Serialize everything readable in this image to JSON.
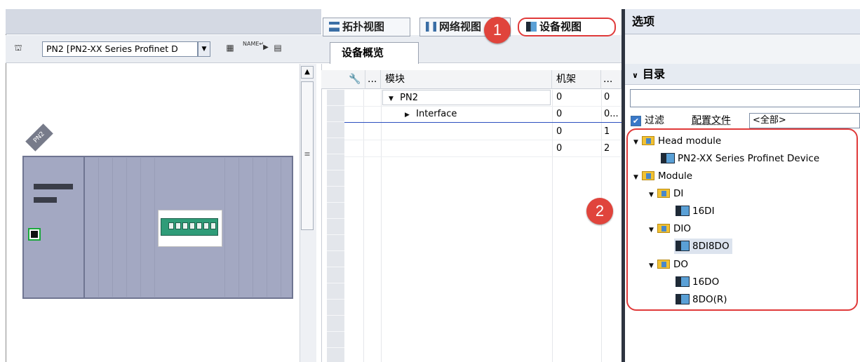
{
  "tabs": {
    "topology": "拓扑视图",
    "network": "网络视图",
    "device": "设备视图"
  },
  "callouts": {
    "one": "1",
    "two": "2"
  },
  "left_pane": {
    "device_select": "PN2 [PN2-XX Series Profinet D",
    "badge": "PN2"
  },
  "overview": {
    "tab": "设备概览",
    "columns": {
      "module": "模块",
      "rack": "机架",
      "more": "...",
      "icon_more": "..."
    },
    "rows": [
      {
        "module": "PN2",
        "rack": "0",
        "slot": "0"
      },
      {
        "module": "Interface",
        "rack": "0",
        "slot": "0..."
      },
      {
        "module": "",
        "rack": "0",
        "slot": "1"
      },
      {
        "module": "",
        "rack": "0",
        "slot": "2"
      }
    ]
  },
  "right_panel": {
    "title": "选项",
    "catalog_header": "目录",
    "filter_label": "过滤",
    "profile_label": "配置文件",
    "profile_value": "<全部>",
    "tree": {
      "head_module": "Head module",
      "device": "PN2-XX Series Profinet Device",
      "module": "Module",
      "di": "DI",
      "di_16": "16DI",
      "dio": "DIO",
      "dio_8": "8DI8DO",
      "do": "DO",
      "do_16": "16DO",
      "do_8r": "8DO(R)"
    }
  },
  "icons": {
    "toolbar": [
      "device-tree-icon",
      "zoom-fit-icon",
      "name-icon",
      "arrow-right-icon",
      "overview-icon"
    ],
    "filter_checked": "✔"
  },
  "colors": {
    "highlight_red": "#e03a3a",
    "rack_fill": "#a3a8c2",
    "port_green": "#1aa83a",
    "panel_divider": "#2e3440"
  }
}
